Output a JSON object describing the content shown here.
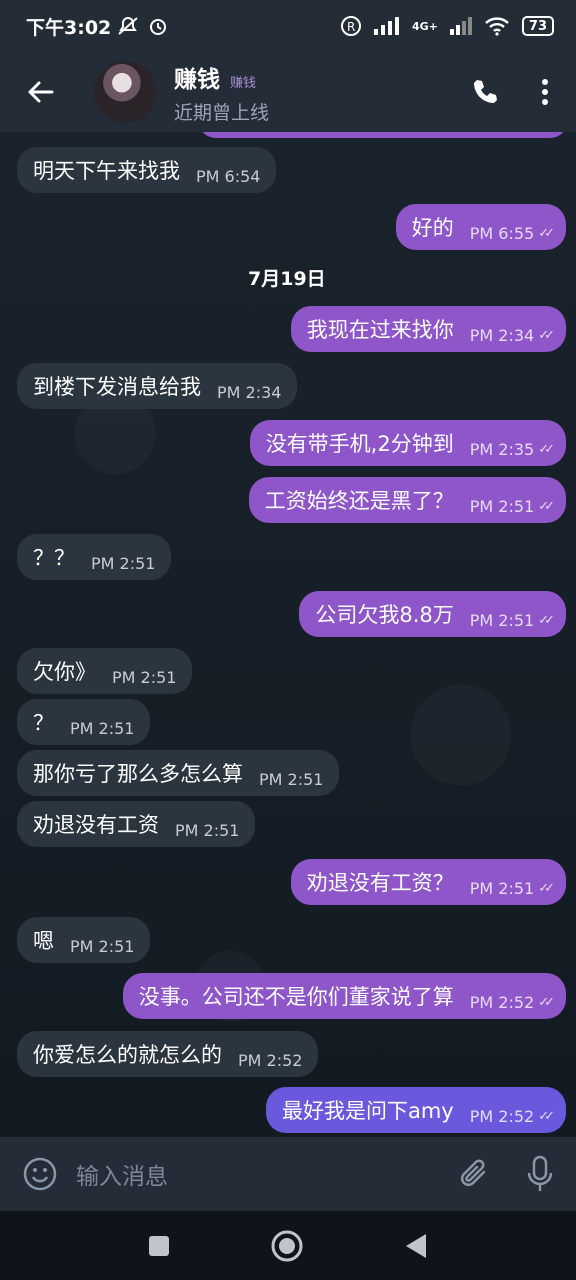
{
  "status": {
    "time": "下午3:02",
    "network": "4G+",
    "battery": "73"
  },
  "header": {
    "name": "赚钱",
    "tag": "赚钱",
    "status": "近期曾上线"
  },
  "date_separator": "7月19日",
  "messages": [
    {
      "dir": "in",
      "text": "明天下午来找我",
      "time": "PM 6:54"
    },
    {
      "dir": "out",
      "text": "好的",
      "time": "PM 6:55"
    },
    {
      "dir": "out",
      "text": "我现在过来找你",
      "time": "PM 2:34"
    },
    {
      "dir": "in",
      "text": "到楼下发消息给我",
      "time": "PM 2:34"
    },
    {
      "dir": "out",
      "text": "没有带手机,2分钟到",
      "time": "PM 2:35"
    },
    {
      "dir": "out",
      "text": "工资始终还是黑了？",
      "time": "PM 2:51"
    },
    {
      "dir": "in",
      "text": "？？",
      "time": "PM 2:51"
    },
    {
      "dir": "out",
      "text": "公司欠我8.8万",
      "time": "PM 2:51"
    },
    {
      "dir": "in",
      "text": "欠你》",
      "time": "PM 2:51"
    },
    {
      "dir": "in",
      "text": "？",
      "time": "PM 2:51"
    },
    {
      "dir": "in",
      "text": "那你亏了那么多怎么算",
      "time": "PM 2:51"
    },
    {
      "dir": "in",
      "text": "劝退没有工资",
      "time": "PM 2:51"
    },
    {
      "dir": "out",
      "text": "劝退没有工资？",
      "time": "PM 2:51"
    },
    {
      "dir": "in",
      "text": "嗯",
      "time": "PM 2:51"
    },
    {
      "dir": "out",
      "text": "没事。公司还不是你们董家说了算",
      "time": "PM 2:52"
    },
    {
      "dir": "in",
      "text": "你爱怎么的就怎么的",
      "time": "PM 2:52"
    },
    {
      "dir": "out",
      "text": "最好我是问下amy",
      "time": "PM 2:52"
    }
  ],
  "input": {
    "placeholder": "输入消息"
  },
  "colors": {
    "outgoing": "#8e56c8",
    "outgoing_latest": "#6a59dd",
    "incoming": "#2b3540",
    "header": "#232c37"
  },
  "icons": [
    "back-arrow-icon",
    "phone-icon",
    "more-vert-icon",
    "emoji-icon",
    "attach-icon",
    "mic-icon",
    "nav-recent-icon",
    "nav-home-icon",
    "nav-back-icon"
  ]
}
